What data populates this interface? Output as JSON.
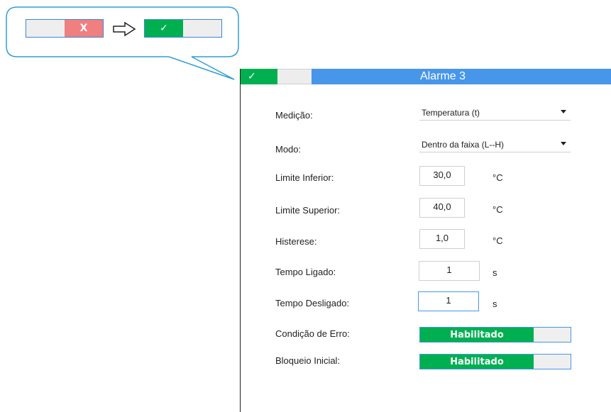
{
  "callout": {
    "before": {
      "on_label": "",
      "off_label": "X"
    },
    "after": {
      "on_label": "✓",
      "off_label": ""
    },
    "arrow_icon": "right-arrow-icon"
  },
  "panel": {
    "header": {
      "toggle_on_label": "✓",
      "title": "Alarme 3"
    },
    "fields": {
      "medicao": {
        "label": "Medição:",
        "value": "Temperatura (t)"
      },
      "modo": {
        "label": "Modo:",
        "value": "Dentro da faixa (L--H)"
      },
      "limite_inferior": {
        "label": "Limite Inferior:",
        "value": "30,0",
        "unit": "°C"
      },
      "limite_superior": {
        "label": "Limite Superior:",
        "value": "40,0",
        "unit": "°C"
      },
      "histerese": {
        "label": "Histerese:",
        "value": "1,0",
        "unit": "°C"
      },
      "tempo_ligado": {
        "label": "Tempo Ligado:",
        "value": "1",
        "unit": "s"
      },
      "tempo_desligado": {
        "label": "Tempo Desligado:",
        "value": "1",
        "unit": "s"
      },
      "condicao_erro": {
        "label": "Condição de Erro:",
        "value": "Habilitado"
      },
      "bloqueio_inicial": {
        "label": "Bloqueio Inicial:",
        "value": "Habilitado"
      }
    }
  },
  "colors": {
    "accent_blue": "#4796ea",
    "on_green": "#00b050",
    "off_red": "#f07f80"
  }
}
